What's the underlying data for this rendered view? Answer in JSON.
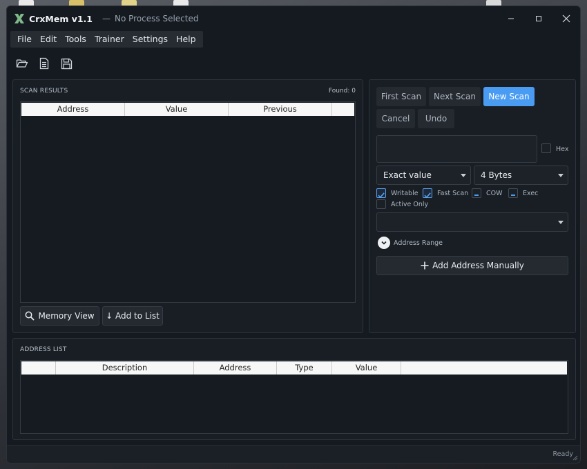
{
  "window": {
    "app_title": "CrxMem v1.1",
    "separator": "—",
    "process": "No Process Selected"
  },
  "menu": [
    "File",
    "Edit",
    "Tools",
    "Trainer",
    "Settings",
    "Help"
  ],
  "scan_results": {
    "title": "SCAN RESULTS",
    "found": "Found: 0",
    "columns": [
      "Address",
      "Value",
      "Previous"
    ],
    "memory_view_label": "Memory View",
    "add_to_list_label": "↓ Add to List"
  },
  "scan": {
    "first_scan": "First Scan",
    "next_scan": "Next Scan",
    "new_scan": "New Scan",
    "cancel": "Cancel",
    "undo": "Undo",
    "value": "",
    "hex_label": "Hex",
    "scan_type": "Exact value",
    "value_type": "4 Bytes",
    "options": {
      "writable": "Writable",
      "fast_scan": "Fast Scan",
      "cow": "COW",
      "exec": "Exec",
      "active_only": "Active Only"
    },
    "module_select": "",
    "address_range_label": "Address Range",
    "add_manual_label": "Add Address Manually"
  },
  "address_list": {
    "title": "ADDRESS LIST",
    "columns": [
      "",
      "Description",
      "Address",
      "Type",
      "Value"
    ]
  },
  "status": {
    "text": "Ready"
  },
  "colors": {
    "accent": "#4a9cf3",
    "window_bg": "#151a21",
    "panel_bg": "#191e25"
  }
}
